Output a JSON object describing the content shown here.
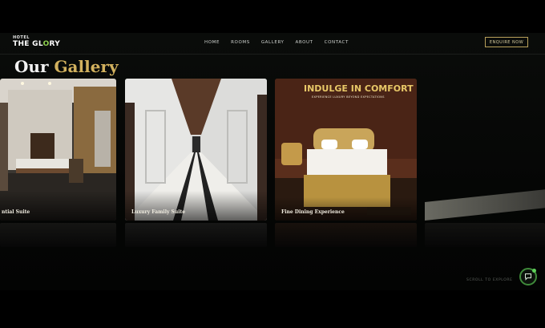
{
  "brand": {
    "hotel_label": "HOTEL",
    "name_part1": "THE GL",
    "name_highlight": "O",
    "name_part2": "RY"
  },
  "nav": {
    "items": [
      "HOME",
      "ROOMS",
      "GALLERY",
      "ABOUT",
      "CONTACT"
    ],
    "cta": "ENQUIRE NOW"
  },
  "gallery": {
    "title_plain": "Our",
    "title_accent": "Gallery",
    "cards": [
      {
        "caption": "ntial Suite"
      },
      {
        "caption": "Luxury Family Suite"
      },
      {
        "caption": "Fine Dining Experience",
        "poster_headline": "INDULGE IN COMFORT",
        "poster_subline": "EXPERIENCE LUXURY BEYOND EXPECTATIONS"
      }
    ]
  },
  "scroll_hint": "SCROLL TO EXPLORE",
  "colors": {
    "accent_gold": "#d2b15e",
    "brand_green": "#8fd14f",
    "background": "#050605"
  },
  "icons": [
    "chat-icon"
  ]
}
